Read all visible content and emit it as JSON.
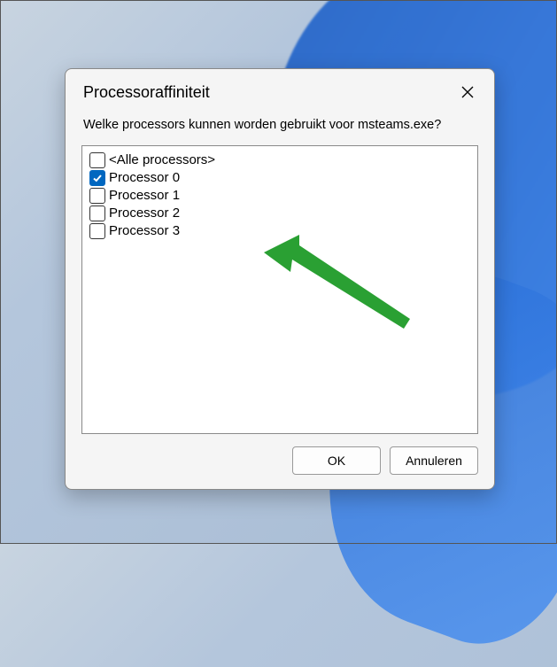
{
  "dialog": {
    "title": "Processoraffiniteit",
    "question": "Welke processors kunnen worden gebruikt voor msteams.exe?",
    "items": [
      {
        "label": "<Alle processors>",
        "checked": false
      },
      {
        "label": "Processor 0",
        "checked": true
      },
      {
        "label": "Processor 1",
        "checked": false
      },
      {
        "label": "Processor 2",
        "checked": false
      },
      {
        "label": "Processor 3",
        "checked": false
      }
    ],
    "buttons": {
      "ok": "OK",
      "cancel": "Annuleren"
    }
  },
  "colors": {
    "accent": "#0067c0",
    "arrow": "#2aa033"
  }
}
